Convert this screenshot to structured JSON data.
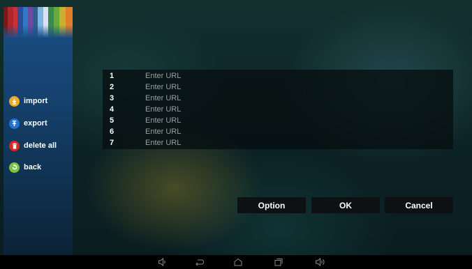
{
  "colors": {
    "import_icon": "#f2a922",
    "export_icon": "#1e73d8",
    "delete_icon": "#e0241e",
    "back_icon": "#7dc243",
    "sidebar_stripes": [
      "#7a1818",
      "#b0262a",
      "#c8333a",
      "#2b4e9a",
      "#2c7ac8",
      "#6b4aa0",
      "#2f5e8f",
      "#7fb4e0",
      "#d7e4ef",
      "#3a8a4a",
      "#6aa93b",
      "#c8b030",
      "#e07f2a"
    ]
  },
  "sidebar": {
    "items": [
      {
        "label": "import",
        "icon": "download-circle-icon"
      },
      {
        "label": "export",
        "icon": "upload-circle-icon"
      },
      {
        "label": "delete all",
        "icon": "trash-icon"
      },
      {
        "label": "back",
        "icon": "back-circle-icon"
      }
    ]
  },
  "url_list": {
    "rows": [
      {
        "number": "1",
        "placeholder": "Enter URL"
      },
      {
        "number": "2",
        "placeholder": "Enter URL"
      },
      {
        "number": "3",
        "placeholder": "Enter URL"
      },
      {
        "number": "4",
        "placeholder": "Enter URL"
      },
      {
        "number": "5",
        "placeholder": "Enter URL"
      },
      {
        "number": "6",
        "placeholder": "Enter URL"
      },
      {
        "number": "7",
        "placeholder": "Enter URL"
      }
    ]
  },
  "buttons": {
    "option": "Option",
    "ok": "OK",
    "cancel": "Cancel"
  },
  "navbar": {
    "icons": [
      "volume-down-icon",
      "back-icon",
      "home-icon",
      "recent-apps-icon",
      "volume-up-icon"
    ]
  }
}
